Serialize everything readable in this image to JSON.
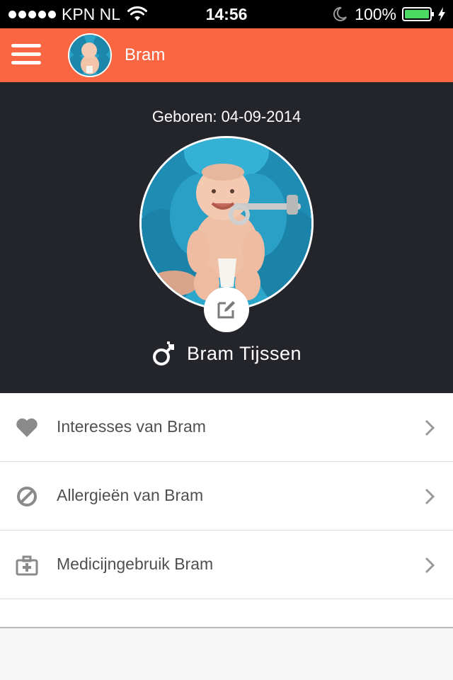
{
  "status_bar": {
    "carrier": "KPN NL",
    "time": "14:56",
    "battery": "100%"
  },
  "header": {
    "title": "Bram"
  },
  "profile": {
    "birth_date": "Geboren: 04-09-2014",
    "name": "Bram Tijssen",
    "gender_icon": "male-female-icon"
  },
  "menu_items": [
    {
      "label": "Interesses van Bram",
      "icon": "heart-icon"
    },
    {
      "label": "Allergieën van Bram",
      "icon": "ban-icon"
    },
    {
      "label": "Medicijngebruik Bram",
      "icon": "medkit-icon"
    }
  ],
  "colors": {
    "header": "#f96641",
    "profile_background": "#24252a",
    "battery": "#4cd964"
  }
}
